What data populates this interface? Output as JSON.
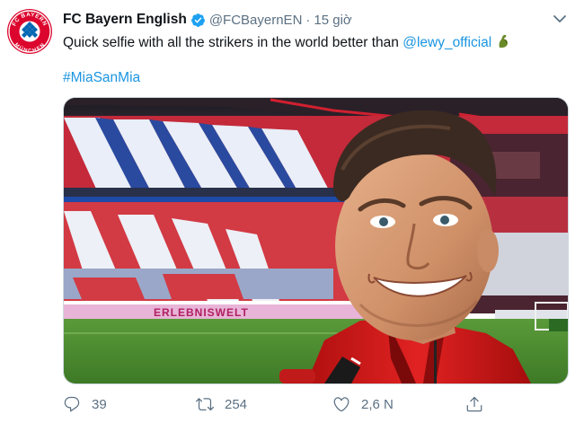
{
  "tweet": {
    "display_name": "FC Bayern English",
    "handle": "@FCBayernEN",
    "separator": "·",
    "time": "15 giờ",
    "text_before": "Quick selfie with all the strikers in the world better than ",
    "mention": "@lewy_official",
    "hashtag": "#MiaSanMia",
    "verified_icon": "verified-badge-icon",
    "emoji_icon": "flexed-biceps-emoji"
  },
  "avatar": {
    "logo_top": "FC BAYERN",
    "logo_bottom": "MÜNCHEN"
  },
  "photo": {
    "board_text": "ERLEBNISWELT"
  },
  "actions": {
    "reply_count": "39",
    "retweet_count": "254",
    "like_count": "2,6 N"
  },
  "colors": {
    "link": "#1b95e0",
    "muted": "#5b7083",
    "bayern_red": "#dc052d",
    "bayern_blue": "#0066b2"
  }
}
